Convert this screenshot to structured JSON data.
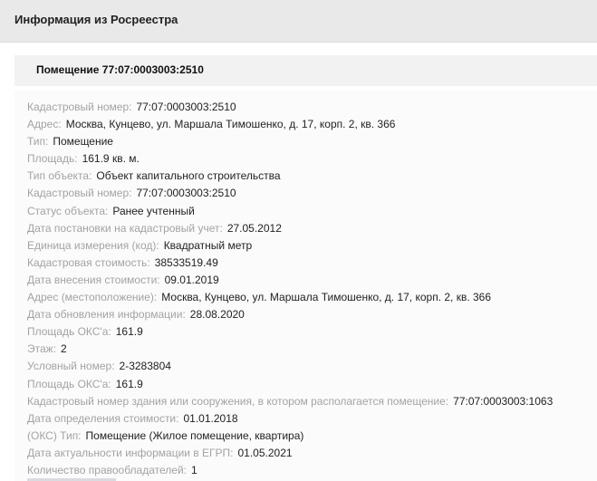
{
  "header": {
    "title": "Информация из Росреестра"
  },
  "object": {
    "title": "Помещение 77:07:0003003:2510"
  },
  "fields": [
    {
      "label": "Кадастровый номер:",
      "value": "77:07:0003003:2510"
    },
    {
      "label": "Адрес:",
      "value": "Москва, Кунцево, ул. Маршала Тимошенко, д. 17, корп. 2, кв. 366"
    },
    {
      "label": "Тип:",
      "value": "Помещение"
    },
    {
      "label": "Площадь:",
      "value": "161.9 кв. м."
    },
    {
      "label": "Тип объекта:",
      "value": "Объект капитального строительства"
    },
    {
      "label": "Кадастровый номер:",
      "value": "77:07:0003003:2510"
    },
    {
      "label": "Статус объекта:",
      "value": "Ранее учтенный"
    },
    {
      "label": "Дата постановки на кадастровый учет:",
      "value": "27.05.2012"
    },
    {
      "label": "Единица измерения (код):",
      "value": "Квадратный метр"
    },
    {
      "label": "Кадастровая стоимость:",
      "value": "38533519.49"
    },
    {
      "label": "Дата внесения стоимости:",
      "value": "09.01.2019"
    },
    {
      "label": "Адрес (местоположение):",
      "value": "Москва, Кунцево, ул. Маршала Тимошенко, д. 17, корп. 2, кв. 366"
    },
    {
      "label": "Дата обновления информации:",
      "value": "28.08.2020"
    },
    {
      "label": "Площадь ОКС'а:",
      "value": "161.9"
    },
    {
      "label": "Этаж:",
      "value": "2"
    },
    {
      "label": "Условный номер:",
      "value": "2-3283804"
    },
    {
      "label": "Площадь ОКС'а:",
      "value": "161.9"
    },
    {
      "label": "Кадастровый номер здания или сооружения, в котором располагается помещение:",
      "value": "77:07:0003003:1063"
    },
    {
      "label": "Дата определения стоимости:",
      "value": "01.01.2018"
    },
    {
      "label": "(ОКС) Тип:",
      "value": "Помещение (Жилое помещение, квартира)"
    },
    {
      "label": "Дата актуальности информации в ЕГРП:",
      "value": "01.05.2021"
    },
    {
      "label": "Количество правообладателей:",
      "value": "1"
    }
  ]
}
